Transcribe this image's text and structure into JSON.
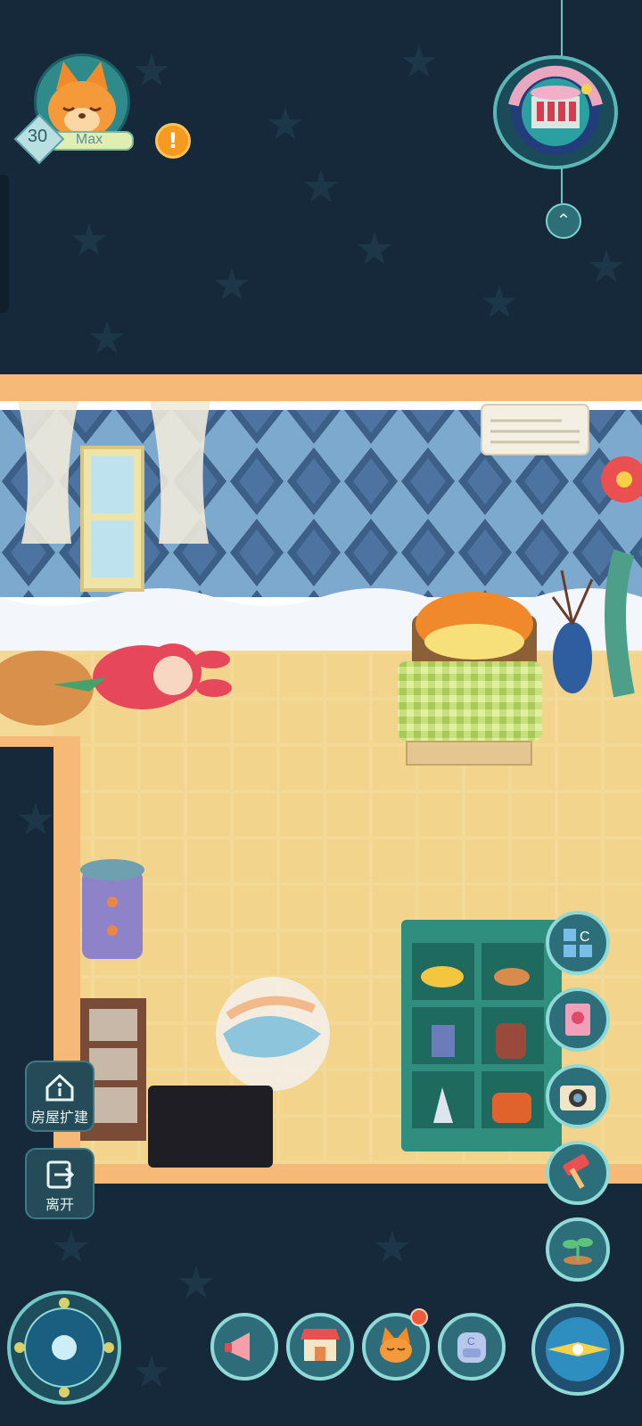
{
  "hud": {
    "player_level": "30",
    "level_status": "Max",
    "alert_icon": "exclamation-icon"
  },
  "side_buttons": {
    "expand_house_label": "房屋扩建",
    "leave_label": "离开"
  },
  "right_buttons": [
    "layout-c-icon",
    "book-icon",
    "camera-icon",
    "hammer-icon",
    "sprout-icon"
  ],
  "bottom_bar": [
    "megaphone-icon",
    "shop-icon",
    "fox-icon",
    "backpack-icon"
  ],
  "colors": {
    "background": "#16293a",
    "accent": "#8fd9d6",
    "floor": "#f4d896",
    "wall_pattern": "#3b5f86",
    "alert": "#f49a20"
  }
}
